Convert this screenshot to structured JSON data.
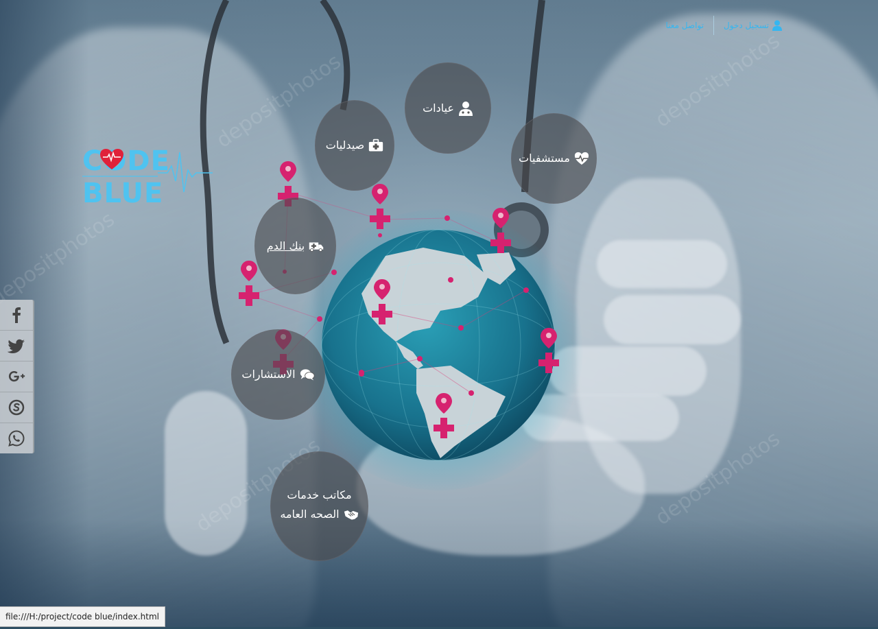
{
  "topnav": {
    "login_label": "تسجيل دخول",
    "contact_label": "تواصل معنا"
  },
  "logo": {
    "line1": "CODE",
    "line2": "BLUE"
  },
  "services": {
    "clinics": "عيادات",
    "hospitals": "مستشفيات",
    "pharmacies": "صيدليات",
    "blood_bank": "بنك الدم",
    "consultations": "الاستشارات",
    "public_health_line1": "مكاتب خدمات",
    "public_health_line2": "الصحه العامه"
  },
  "social": [
    "facebook-icon",
    "twitter-icon",
    "google-plus-icon",
    "skype-icon",
    "whatsapp-icon"
  ],
  "status_bar": {
    "url": "file:///H:/project/code blue/index.html"
  },
  "watermark": "depositphotos",
  "colors": {
    "accent_blue": "#35b6f0",
    "logo_blue": "#4fc3f0",
    "heart_red": "#e0213a",
    "pin_magenta": "#d6226f"
  }
}
